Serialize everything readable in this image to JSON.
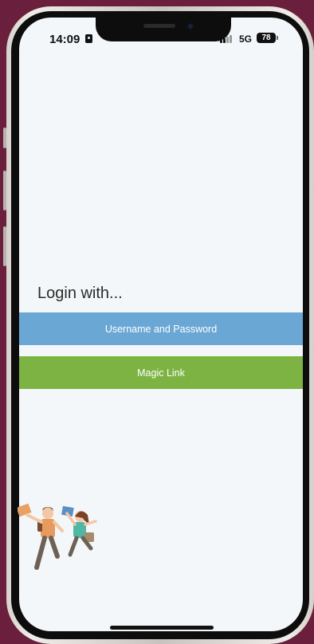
{
  "status_bar": {
    "time": "14:09",
    "network": "5G",
    "battery": "78"
  },
  "login": {
    "title": "Login with...",
    "username_password_label": "Username and Password",
    "magic_link_label": "Magic Link"
  },
  "colors": {
    "screen_background": "#f4f7f9",
    "username_password_button": "#6aa7d4",
    "magic_link_button": "#7cb342",
    "wallpaper": "#6a1f3c"
  },
  "illustration": {
    "name": "two-students-jumping-illustration"
  }
}
